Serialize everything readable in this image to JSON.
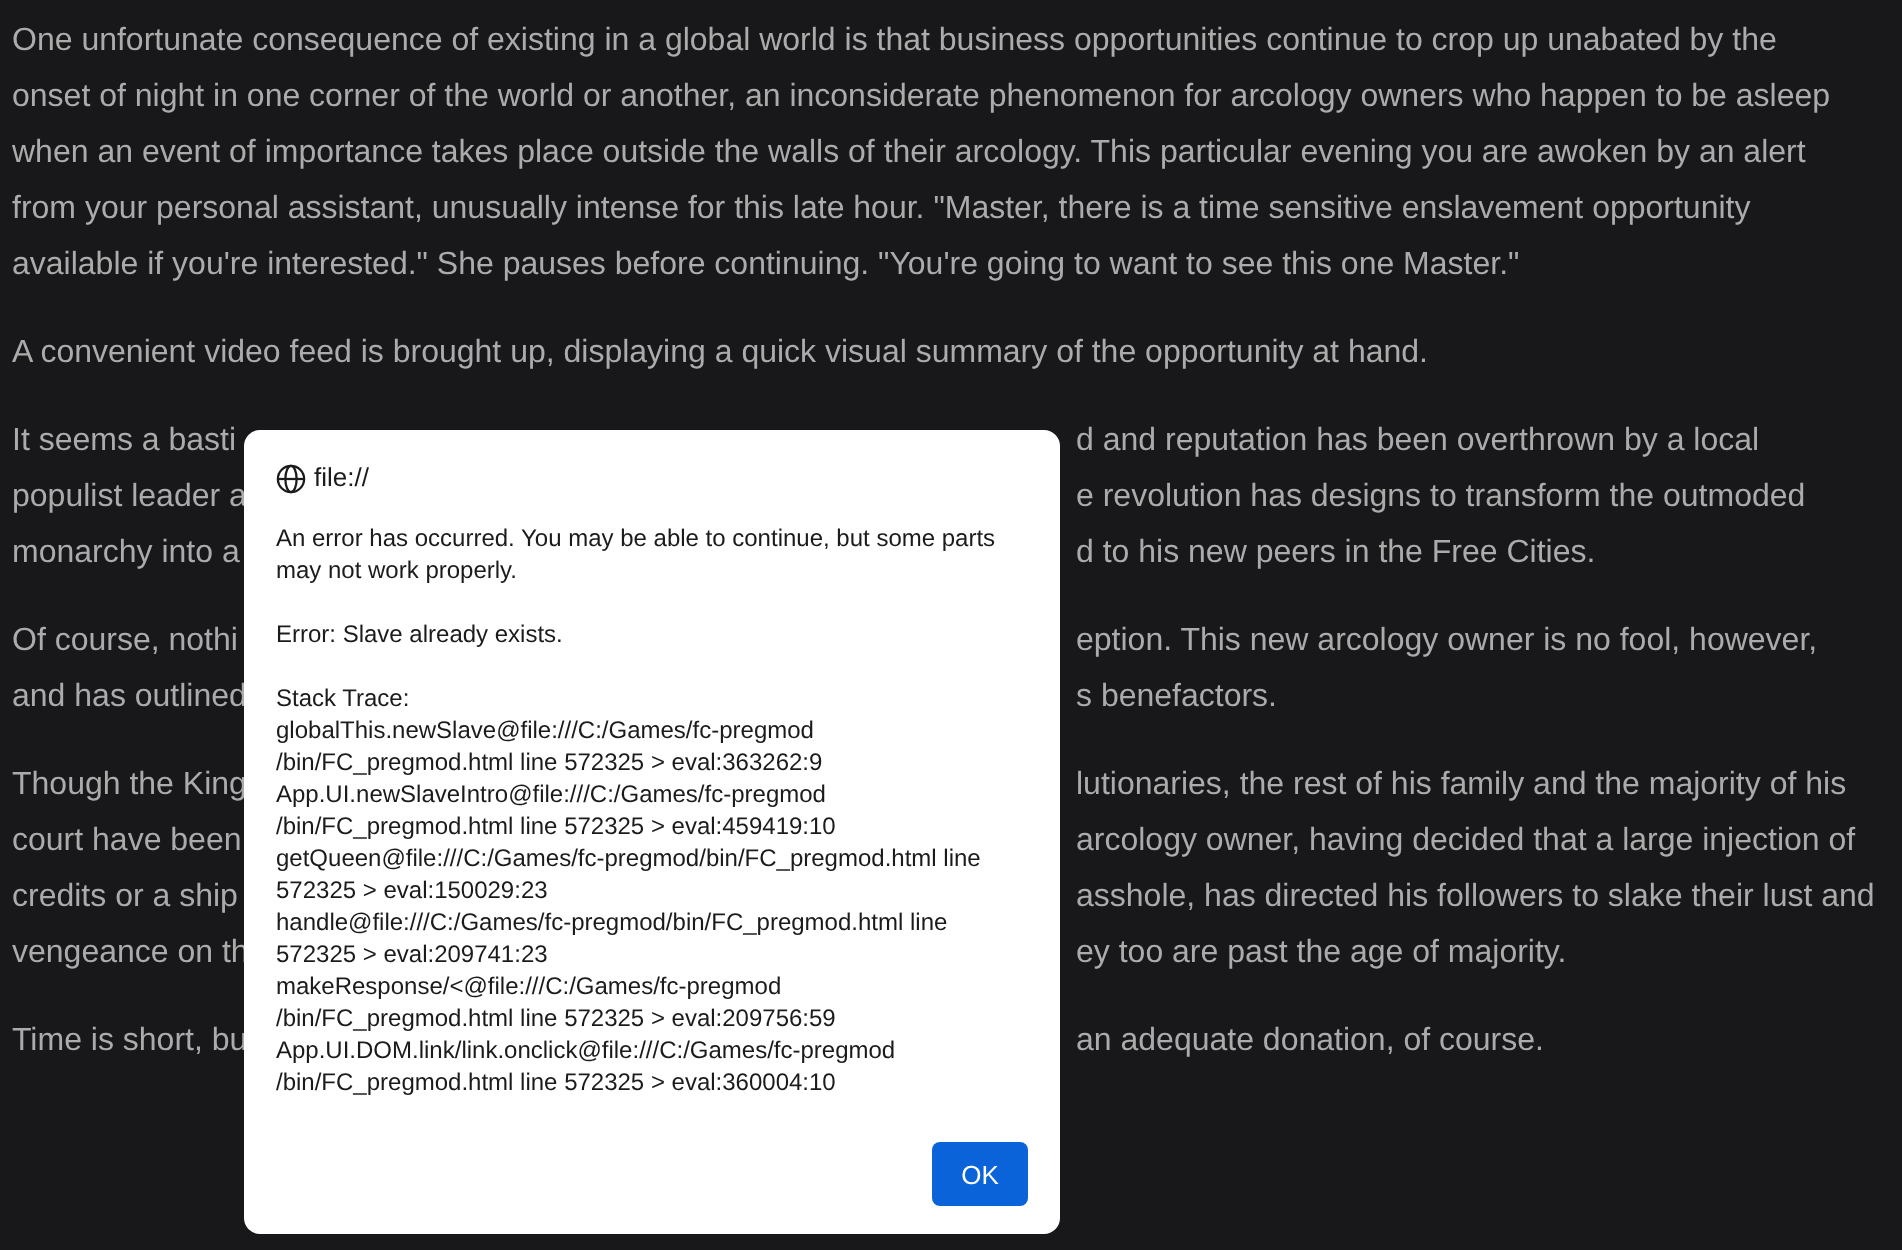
{
  "story": {
    "paragraphs": [
      {
        "lines": [
          "One unfortunate consequence of existing in a global world is that business opportunities continue to crop up unabated by the",
          "onset of night in one corner of the world or another, an inconsiderate phenomenon for arcology owners who happen to be asleep",
          "when an event of importance takes place outside the walls of their arcology. This particular evening you are awoken by an alert",
          "from your personal assistant, unusually intense for this late hour. \"Master, there is a time sensitive enslavement opportunity",
          "available if you're interested.\" She pauses before continuing. \"You're going to want to see this one Master.\""
        ]
      },
      {
        "lines": [
          "A convenient video feed is brought up, displaying a quick visual summary of the opportunity at hand."
        ]
      }
    ],
    "covered_paragraphs": [
      {
        "lines": [
          {
            "left": "It seems a basti",
            "right": "d and reputation has been overthrown by a local"
          },
          {
            "left": "populist leader a",
            "right": "e revolution has designs to transform the outmoded"
          },
          {
            "left": "monarchy into a",
            "right": "d to his new peers in the Free Cities."
          }
        ]
      },
      {
        "lines": [
          {
            "left": "Of course, nothi",
            "right": "eption. This new arcology owner is no fool, however,"
          },
          {
            "left": "and has outlined",
            "right": "s benefactors."
          }
        ]
      },
      {
        "lines": [
          {
            "left": "Though the King",
            "right": "lutionaries, the rest of his family and the majority of his"
          },
          {
            "left": "court have been",
            "right": "arcology owner, having decided that a large injection of"
          },
          {
            "left": "credits or a ship",
            "right": "asshole, has directed his followers to slake their lust and"
          },
          {
            "left": "vengeance on th",
            "right": "ey too are past the age of majority."
          }
        ]
      },
      {
        "lines": [
          {
            "left": "Time is short, bu",
            "right": "an adequate donation, of course."
          }
        ]
      }
    ]
  },
  "dialog": {
    "origin": "file://",
    "message": [
      "An error has occurred. You may be able to continue, but some parts",
      "may not work properly."
    ],
    "error": "Error: Slave already exists.",
    "stack_trace_label": "Stack Trace:",
    "stack_trace": [
      "globalThis.newSlave@file:///C:/Games/fc-pregmod",
      "/bin/FC_pregmod.html line 572325 > eval:363262:9",
      "App.UI.newSlaveIntro@file:///C:/Games/fc-pregmod",
      "/bin/FC_pregmod.html line 572325 > eval:459419:10",
      "getQueen@file:///C:/Games/fc-pregmod/bin/FC_pregmod.html line",
      "572325 > eval:150029:23",
      "handle@file:///C:/Games/fc-pregmod/bin/FC_pregmod.html line",
      "572325 > eval:209741:23",
      "makeResponse/<@file:///C:/Games/fc-pregmod",
      "/bin/FC_pregmod.html line 572325 > eval:209756:59",
      "App.UI.DOM.link/link.onclick@file:///C:/Games/fc-pregmod",
      "/bin/FC_pregmod.html line 572325 > eval:360004:10"
    ],
    "button": "OK"
  }
}
